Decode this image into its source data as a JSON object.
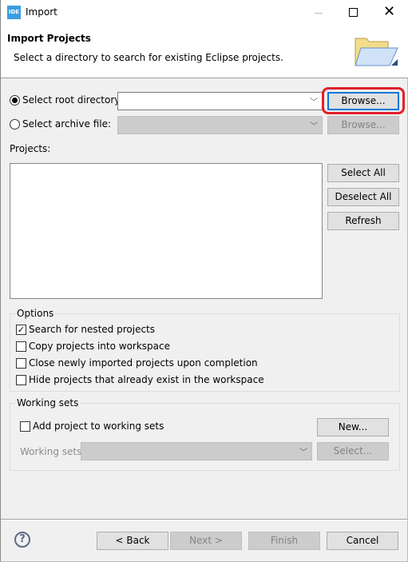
{
  "window": {
    "icon_text": "IDE",
    "title": "Import"
  },
  "header": {
    "title": "Import Projects",
    "subtitle": "Select a directory to search for existing Eclipse projects."
  },
  "source": {
    "root_label": "Select root directory:",
    "root_value": "",
    "archive_label": "Select archive file:",
    "archive_value": "",
    "browse": "Browse...",
    "browse_archive": "Browse...",
    "selected": "root"
  },
  "projects": {
    "label": "Projects:",
    "items": [],
    "select_all": "Select All",
    "deselect_all": "Deselect All",
    "refresh": "Refresh"
  },
  "options": {
    "label": "Options",
    "items": [
      {
        "label": "Search for nested projects",
        "checked": true
      },
      {
        "label": "Copy projects into workspace",
        "checked": false
      },
      {
        "label": "Close newly imported projects upon completion",
        "checked": false
      },
      {
        "label": "Hide projects that already exist in the workspace",
        "checked": false
      }
    ]
  },
  "working_sets": {
    "label": "Working sets",
    "add_label": "Add project to working sets",
    "add_checked": false,
    "new": "New...",
    "sets_label": "Working sets:",
    "select": "Select..."
  },
  "footer": {
    "back": "< Back",
    "next": "Next >",
    "finish": "Finish",
    "cancel": "Cancel"
  },
  "colors": {
    "highlight": "#e0202a",
    "focus": "#0078d7"
  }
}
